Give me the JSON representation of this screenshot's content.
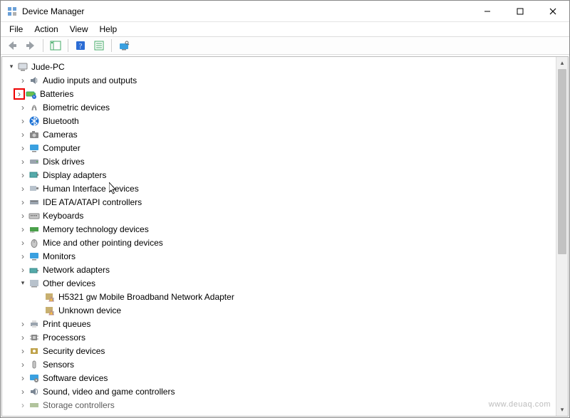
{
  "title": "Device Manager",
  "menu": {
    "file": "File",
    "action": "Action",
    "view": "View",
    "help": "Help"
  },
  "root": "Jude-PC",
  "nodes": {
    "audio": "Audio inputs and outputs",
    "batteries": "Batteries",
    "biometric": "Biometric devices",
    "bluetooth": "Bluetooth",
    "cameras": "Cameras",
    "computer": "Computer",
    "disk": "Disk drives",
    "display": "Display adapters",
    "hid": "Human Interface Devices",
    "ide": "IDE ATA/ATAPI controllers",
    "keyboards": "Keyboards",
    "memtech": "Memory technology devices",
    "mice": "Mice and other pointing devices",
    "monitors": "Monitors",
    "netadapters": "Network adapters",
    "other": "Other devices",
    "other_child1": "H5321 gw Mobile Broadband Network Adapter",
    "other_child2": "Unknown device",
    "printq": "Print queues",
    "processors": "Processors",
    "security": "Security devices",
    "sensors": "Sensors",
    "software": "Software devices",
    "sound": "Sound, video and game controllers",
    "storage": "Storage controllers"
  },
  "watermark": "www.deuaq.com"
}
